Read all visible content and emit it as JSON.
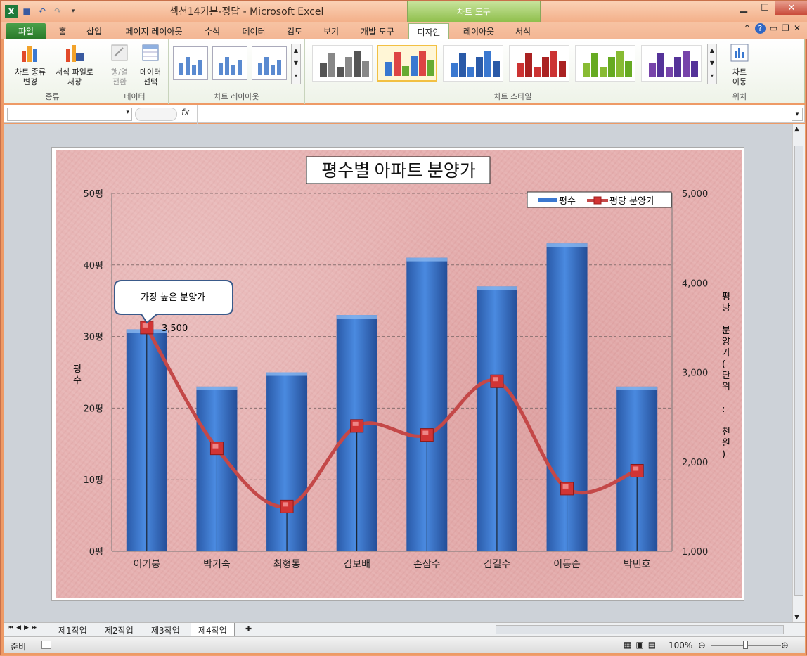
{
  "window": {
    "title": "섹션14기본-정답  -  Microsoft Excel",
    "context_tab_group": "차트 도구"
  },
  "ribbon_tabs": [
    "파일",
    "홈",
    "삽입",
    "페이지 레이아웃",
    "수식",
    "데이터",
    "검토",
    "보기",
    "개발 도구",
    "디자인",
    "레이아웃",
    "서식"
  ],
  "ribbon": {
    "type_group": {
      "btn1": "차트 종류\n변경",
      "btn2": "서식 파일로\n저장",
      "label": "종류"
    },
    "data_group": {
      "btn1": "행/열\n전환",
      "btn2": "데이터\n선택",
      "label": "데이터"
    },
    "layout_group": {
      "label": "차트 레이아웃"
    },
    "style_group": {
      "label": "차트 스타일"
    },
    "location_group": {
      "btn1": "차트\n이동",
      "label": "위치"
    }
  },
  "formula_bar": {
    "fx": "fx",
    "value": ""
  },
  "sheet_tabs": [
    "제1작업",
    "제2작업",
    "제3작업",
    "제4작업"
  ],
  "status": {
    "ready": "준비",
    "zoom": "100%"
  },
  "colors": {
    "bar": "#3a78d0",
    "line": "#c44848",
    "marker": "#d23434",
    "plot_bg": "#e6b0b0",
    "accent_green": "#4aa04a"
  },
  "chart_data": {
    "type": "bar",
    "title": "평수별 아파트 분양가",
    "categories": [
      "이기붕",
      "박기숙",
      "최형통",
      "김보배",
      "손삼수",
      "김길수",
      "이동순",
      "박민호"
    ],
    "series": [
      {
        "name": "평수",
        "type": "bar",
        "axis": "left",
        "values": [
          31,
          23,
          25,
          33,
          41,
          37,
          43,
          23
        ]
      },
      {
        "name": "평당 분양가",
        "type": "line",
        "axis": "right",
        "values": [
          3500,
          2150,
          1500,
          2400,
          2300,
          2900,
          1700,
          1900
        ]
      }
    ],
    "left_axis": {
      "label": "평수",
      "ticks": [
        "0평",
        "10평",
        "20평",
        "30평",
        "40평",
        "50평"
      ],
      "range": [
        0,
        50
      ]
    },
    "right_axis": {
      "label": "평당 분양가(단위 : 천원)",
      "ticks": [
        "1,000",
        "2,000",
        "3,000",
        "4,000",
        "5,000"
      ],
      "range": [
        1000,
        5000
      ]
    },
    "data_label": "3,500",
    "callout": "가장 높은 분양가",
    "legend_position": "top-right",
    "grid": true
  }
}
